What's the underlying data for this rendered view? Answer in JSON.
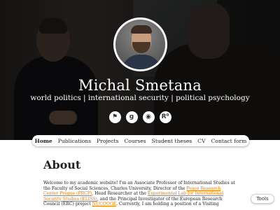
{
  "hero": {
    "name": "Michal Smetana",
    "tagline": "world politics | international security | political psychology",
    "social": [
      {
        "icon": "twitter-icon",
        "glyph": "⚑"
      },
      {
        "icon": "google-scholar-icon",
        "glyph": "g"
      },
      {
        "icon": "researchgate-icon",
        "glyph": "◉"
      },
      {
        "icon": "academia-icon",
        "glyph": "R⁰"
      }
    ]
  },
  "nav": {
    "items": [
      "Home",
      "Publications",
      "Projects",
      "Courses",
      "Student theses",
      "CV",
      "Contact form"
    ],
    "active": "Home"
  },
  "about": {
    "title": "About",
    "t1": "Welcome to my academic website! I'm an Associate Professor of International Studies at the Faculty of Social Sciences, Charles University,  Director of the ",
    "l1": "Peace Research Center Prague (PRCP)",
    "t2": ", Head Researcher at the ",
    "l2": "Experimental Lab for International Security Studies (ELISS)",
    "t3": ", and the Principal Investigator of the European Research Council (ERC) project ",
    "l3": "NUCOOGE",
    "t4": ". Currently, I am holding a position of a Visiting"
  },
  "tools": {
    "label": "Tools"
  },
  "colors": {
    "link": "#e07b00",
    "hero_bg": "#1c1a18"
  }
}
